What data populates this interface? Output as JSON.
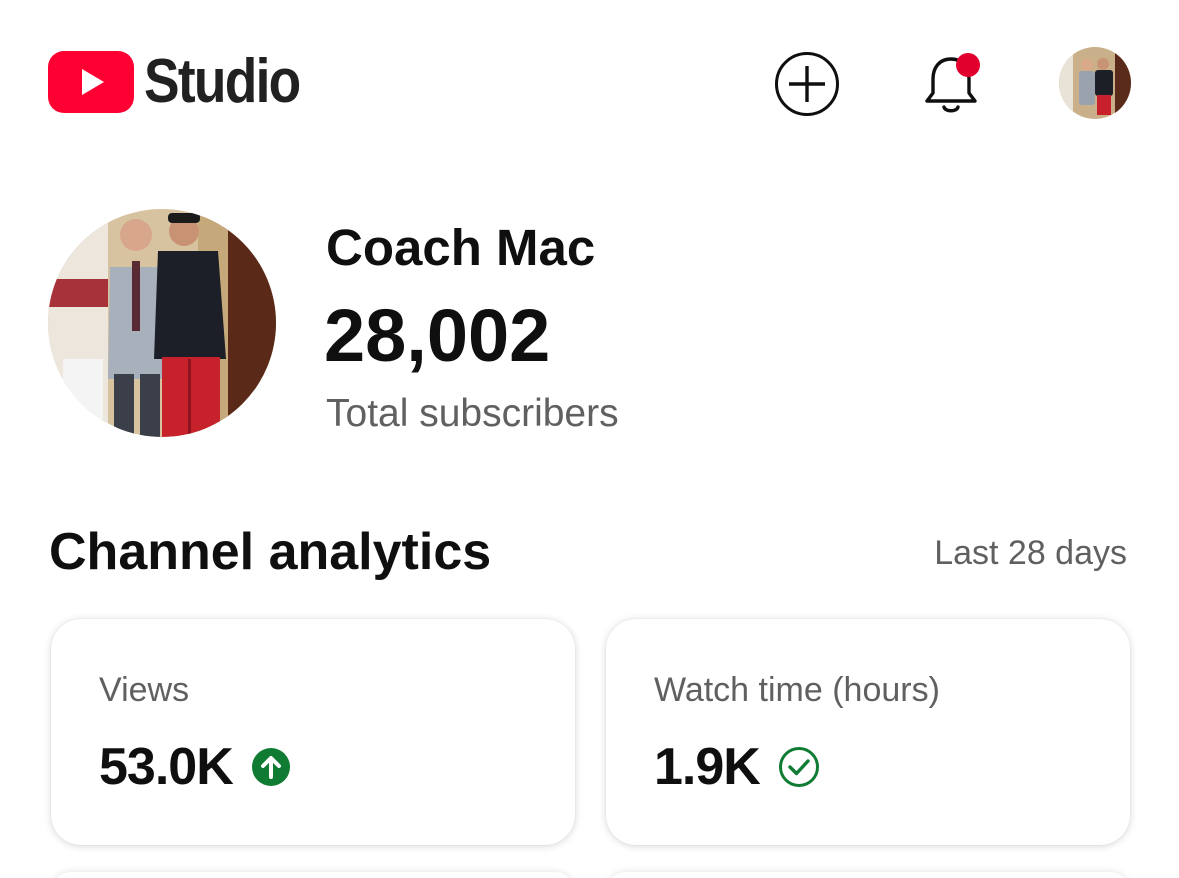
{
  "header": {
    "logo_text": "Studio",
    "icons": {
      "logo": "youtube-play-icon",
      "create": "add-circle-icon",
      "notifications": "bell-icon",
      "account": "avatar"
    },
    "notification_badge_color": "#e1002d",
    "brand_color": "#ff0033"
  },
  "channel": {
    "name": "Coach Mac",
    "subscriber_count": "28,002",
    "subscriber_label": "Total subscribers"
  },
  "analytics": {
    "title": "Channel analytics",
    "range": "Last 28 days",
    "cards": [
      {
        "label": "Views",
        "value": "53.0K",
        "status_icon": "arrow-up-circle-icon",
        "status_color": "#0f7b33"
      },
      {
        "label": "Watch time (hours)",
        "value": "1.9K",
        "status_icon": "check-circle-icon",
        "status_color": "#0f7b33"
      }
    ]
  }
}
